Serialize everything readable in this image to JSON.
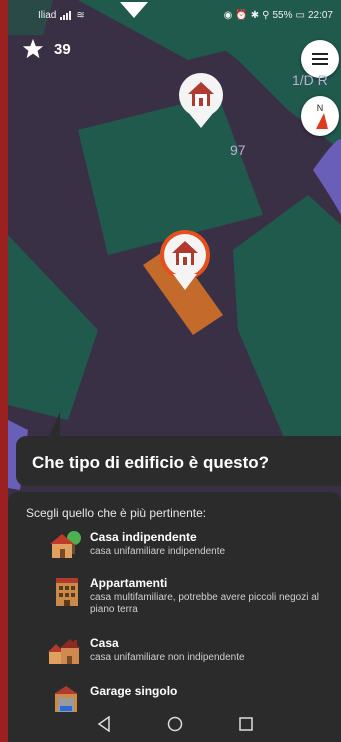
{
  "status_bar": {
    "carrier": "Iliad",
    "battery": "55%",
    "time": "22:07",
    "icons": [
      "signal-icon",
      "wifi-icon",
      "eye-icon",
      "alarm-icon",
      "bluetooth-icon",
      "location-icon",
      "battery-icon"
    ]
  },
  "map": {
    "star_count": "39",
    "label_number": "97",
    "label_address": "1/D R",
    "compass_letter": "N",
    "colors": {
      "background": "#3a3046",
      "building": "#1f5a4d",
      "highlight": "#c46a2a",
      "road": "#6a5fb8"
    }
  },
  "prompt": {
    "question": "Che tipo di edificio è questo?",
    "instruction": "Scegli quello che è più pertinente:"
  },
  "options": [
    {
      "title": "Casa indipendente",
      "subtitle": "casa unifamiliare indipendente",
      "icon": "detached-house-icon"
    },
    {
      "title": "Appartamenti",
      "subtitle": "casa multifamiliare, potrebbe avere piccoli negozi al piano terra",
      "icon": "apartments-icon"
    },
    {
      "title": "Casa",
      "subtitle": "casa unifamiliare non indipendente",
      "icon": "houses-icon"
    },
    {
      "title": "Garage singolo",
      "subtitle": "",
      "icon": "garage-icon"
    }
  ],
  "nav": [
    "back-icon",
    "home-icon",
    "recents-icon"
  ]
}
